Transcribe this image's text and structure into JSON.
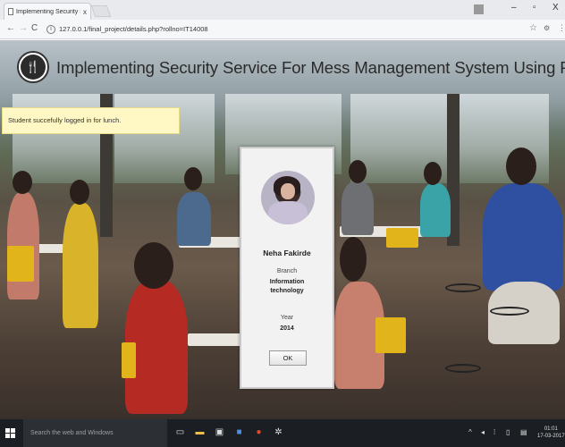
{
  "browser": {
    "tab_title": "Implementing Security S",
    "tab_close": "x",
    "url": "127.0.0.1/final_project/details.php?rollno=IT14008",
    "url_icon": "i",
    "back": "←",
    "forward": "→",
    "reload": "C",
    "star": "☆",
    "ext": "⚙",
    "menu": "⋮",
    "win_min": "–",
    "win_max": "▫",
    "win_close": "X"
  },
  "header": {
    "logo_glyph": "🍴",
    "title": "Implementing Security Service For Mess Management System Using PHP."
  },
  "alert": {
    "message": "Student succefully logged in for lunch."
  },
  "student": {
    "name": "Neha Fakirde",
    "branch_label": "Branch",
    "branch_line1": "Information",
    "branch_line2": "technology",
    "year_label": "Year",
    "year": "2014",
    "ok_label": "OK"
  },
  "taskbar": {
    "search_placeholder": "Search the web and Windows",
    "time": "01:01",
    "date": "17-03-2017"
  },
  "icons": [
    "windows-start-icon",
    "task-view-icon",
    "file-explorer-icon",
    "store-icon",
    "mail-icon",
    "chrome-icon",
    "settings-icon"
  ]
}
